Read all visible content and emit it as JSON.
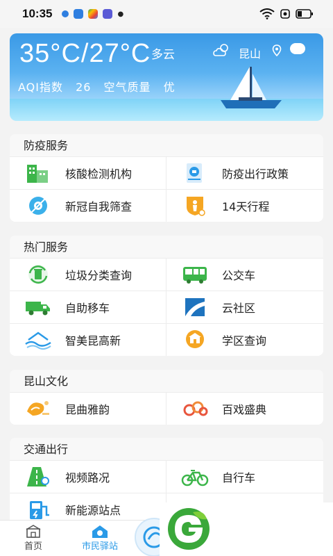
{
  "status": {
    "time": "10:35"
  },
  "weather": {
    "temp_range": "35°C/27°C",
    "condition": "多云",
    "city": "昆山",
    "aqi_label": "AQI指数",
    "aqi_value": "26",
    "quality_label": "空气质量",
    "quality_value": "优"
  },
  "sections": [
    {
      "title": "防疫服务",
      "items": [
        "核酸检测机构",
        "防疫出行政策",
        "新冠自我筛查",
        "14天行程"
      ]
    },
    {
      "title": "热门服务",
      "items": [
        "垃圾分类查询",
        "公交车",
        "自助移车",
        "云社区",
        "智美昆高新",
        "学区查询"
      ]
    },
    {
      "title": "昆山文化",
      "items": [
        "昆曲雅韵",
        "百戏盛典"
      ]
    },
    {
      "title": "交通出行",
      "items": [
        "视频路况",
        "自行车",
        "新能源站点"
      ]
    }
  ],
  "nav": {
    "home": "首页",
    "station": "市民驿站"
  },
  "colors": {
    "accent": "#2a9ae7",
    "green": "#3cb54a",
    "orange": "#f5a623"
  }
}
